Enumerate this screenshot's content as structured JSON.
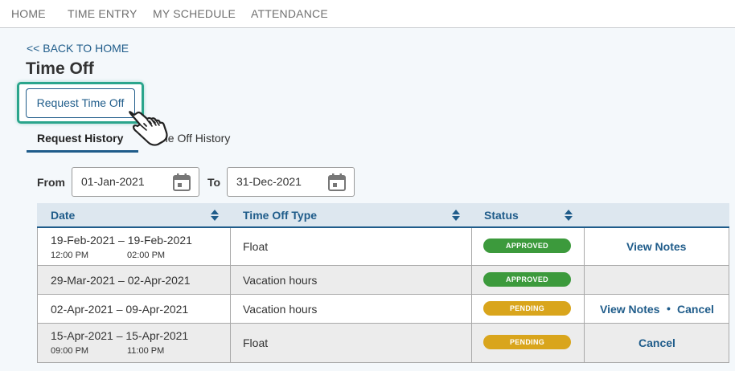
{
  "nav": {
    "items": [
      "HOME",
      "TIME ENTRY",
      "MY SCHEDULE",
      "ATTENDANCE"
    ]
  },
  "back_link": "<< BACK TO HOME",
  "page_title": "Time Off",
  "request_button": "Request Time Off",
  "tabs": [
    "Request History",
    "Time Off History"
  ],
  "filter": {
    "from_label": "From",
    "from_value": "01-Jan-2021",
    "to_label": "To",
    "to_value": "31-Dec-2021"
  },
  "table": {
    "headers": [
      "Date",
      "Time Off Type",
      "Status"
    ],
    "rows": [
      {
        "date": "19-Feb-2021 – 19-Feb-2021",
        "start_time": "12:00 PM",
        "end_time": "02:00 PM",
        "type": "Float",
        "status": "APPROVED",
        "actions": [
          "View Notes"
        ]
      },
      {
        "date": "29-Mar-2021 – 02-Apr-2021",
        "type": "Vacation hours",
        "status": "APPROVED",
        "actions": []
      },
      {
        "date": "02-Apr-2021 – 09-Apr-2021",
        "type": "Vacation hours",
        "status": "PENDING",
        "actions": [
          "View Notes",
          "Cancel"
        ]
      },
      {
        "date": "15-Apr-2021 – 15-Apr-2021",
        "start_time": "09:00 PM",
        "end_time": "11:00 PM",
        "type": "Float",
        "status": "PENDING",
        "actions": [
          "Cancel"
        ]
      }
    ]
  },
  "colors": {
    "link": "#1f5c8a",
    "approved": "#3c9a3c",
    "pending": "#d9a51c",
    "highlight": "#2ba58c"
  },
  "icons": [
    "calendar-icon",
    "sort-icon",
    "hand-pointer-icon"
  ]
}
